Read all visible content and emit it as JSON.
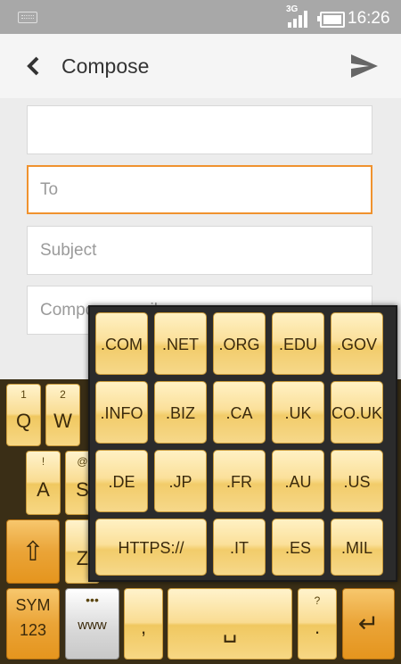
{
  "status": {
    "network": "3G",
    "time": "16:26"
  },
  "header": {
    "title": "Compose"
  },
  "form": {
    "from": {
      "value": "",
      "placeholder": ""
    },
    "to": {
      "value": "",
      "placeholder": "To"
    },
    "subject": {
      "value": "",
      "placeholder": "Subject"
    },
    "body": {
      "value": "",
      "placeholder": "Compose email"
    }
  },
  "keyboard": {
    "row1": [
      {
        "label": "Q",
        "hint": "1"
      },
      {
        "label": "W",
        "hint": "2"
      }
    ],
    "row2": [
      {
        "label": "A",
        "hint": "!"
      },
      {
        "label": "S",
        "hint": "@"
      }
    ],
    "row3": [
      {
        "label": "Z",
        "hint": ""
      }
    ],
    "bottom": {
      "sym_line1": "SYM",
      "sym_line2": "123",
      "www_hint": "•••",
      "www_label": "www",
      "comma": ",",
      "space": "␣",
      "period": ".",
      "period_hint": "?",
      "enter": "↵",
      "shift": "⇧"
    }
  },
  "domains": [
    ".COM",
    ".NET",
    ".ORG",
    ".EDU",
    ".GOV",
    ".INFO",
    ".BIZ",
    ".CA",
    ".UK",
    "CO.UK",
    ".DE",
    ".JP",
    ".FR",
    ".AU",
    ".US",
    "HTTPS://",
    ".IT",
    ".ES",
    ".MIL"
  ],
  "colors": {
    "accent": "#f0922e",
    "key_gold": "#f9dc92",
    "key_orange": "#e5951e"
  }
}
